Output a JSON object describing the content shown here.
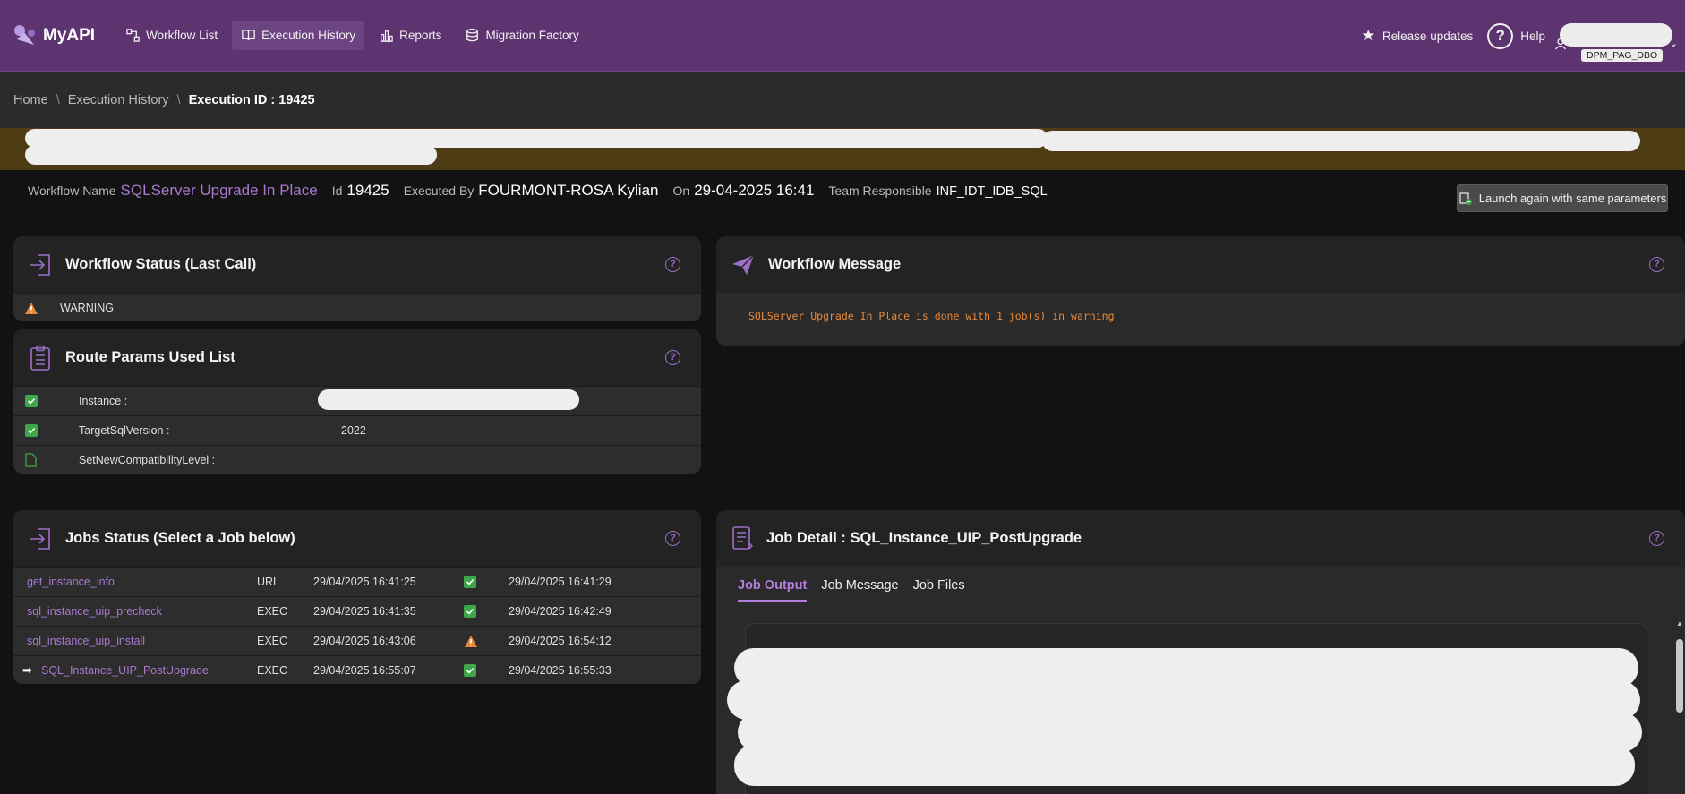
{
  "app": {
    "name": "MyAPI"
  },
  "nav": {
    "items": [
      {
        "label": "Workflow List",
        "icon": "workflow-icon"
      },
      {
        "label": "Execution History",
        "icon": "book-icon",
        "active": true
      },
      {
        "label": "Reports",
        "icon": "bar-chart-icon"
      },
      {
        "label": "Migration Factory",
        "icon": "database-icon"
      }
    ]
  },
  "top_right": {
    "release": "Release updates",
    "help": "Help",
    "user_tag": "DPM_PAG_DBO"
  },
  "breadcrumb": {
    "home": "Home",
    "history": "Execution History",
    "current": "Execution ID : 19425"
  },
  "info": {
    "wf_label": "Workflow Name",
    "wf_value": "SQLServer Upgrade In Place",
    "id_label": "Id",
    "id_value": "19425",
    "by_label": "Executed By",
    "by_value": "FOURMONT-ROSA Kylian",
    "on_label": "On",
    "on_value": "29-04-2025 16:41",
    "team_label": "Team Responsible",
    "team_value": "INF_IDT_IDB_SQL",
    "relaunch": "Launch again with same parameters"
  },
  "status_panel": {
    "title": "Workflow Status (Last Call)",
    "help": "?",
    "value": "WARNING"
  },
  "message_panel": {
    "title": "Workflow Message",
    "help": "?",
    "text": "SQLServer Upgrade In Place is done with 1 job(s) in warning"
  },
  "params_panel": {
    "title": "Route Params Used List",
    "help": "?",
    "rows": [
      {
        "name": "Instance :",
        "value": "",
        "state": "checked"
      },
      {
        "name": "TargetSqlVersion :",
        "value": "2022",
        "state": "checked"
      },
      {
        "name": "SetNewCompatibilityLevel :",
        "value": "",
        "state": "file"
      }
    ]
  },
  "jobs_panel": {
    "title": "Jobs Status (Select a Job below)",
    "help": "?",
    "rows": [
      {
        "name": "get_instance_info",
        "type": "URL",
        "start": "29/04/2025 16:41:25",
        "status": "success",
        "end": "29/04/2025 16:41:29"
      },
      {
        "name": "sql_instance_uip_precheck",
        "type": "EXEC",
        "start": "29/04/2025 16:41:35",
        "status": "success",
        "end": "29/04/2025 16:42:49"
      },
      {
        "name": "sql_instance_uip_install",
        "type": "EXEC",
        "start": "29/04/2025 16:43:06",
        "status": "warning",
        "end": "29/04/2025 16:54:12"
      },
      {
        "name": "SQL_Instance_UIP_PostUpgrade",
        "type": "EXEC",
        "start": "29/04/2025 16:55:07",
        "status": "success",
        "end": "29/04/2025 16:55:33",
        "selected": true
      }
    ]
  },
  "detail_panel": {
    "title": "Job Detail : SQL_Instance_UIP_PostUpgrade",
    "help": "?",
    "tabs": [
      "Job Output",
      "Job Message",
      "Job Files"
    ]
  },
  "colors": {
    "topbar": "#5e3470",
    "accent": "#a979cf",
    "warning": "#e8893a",
    "success": "#3fa64b",
    "banner": "#4e3d14"
  }
}
